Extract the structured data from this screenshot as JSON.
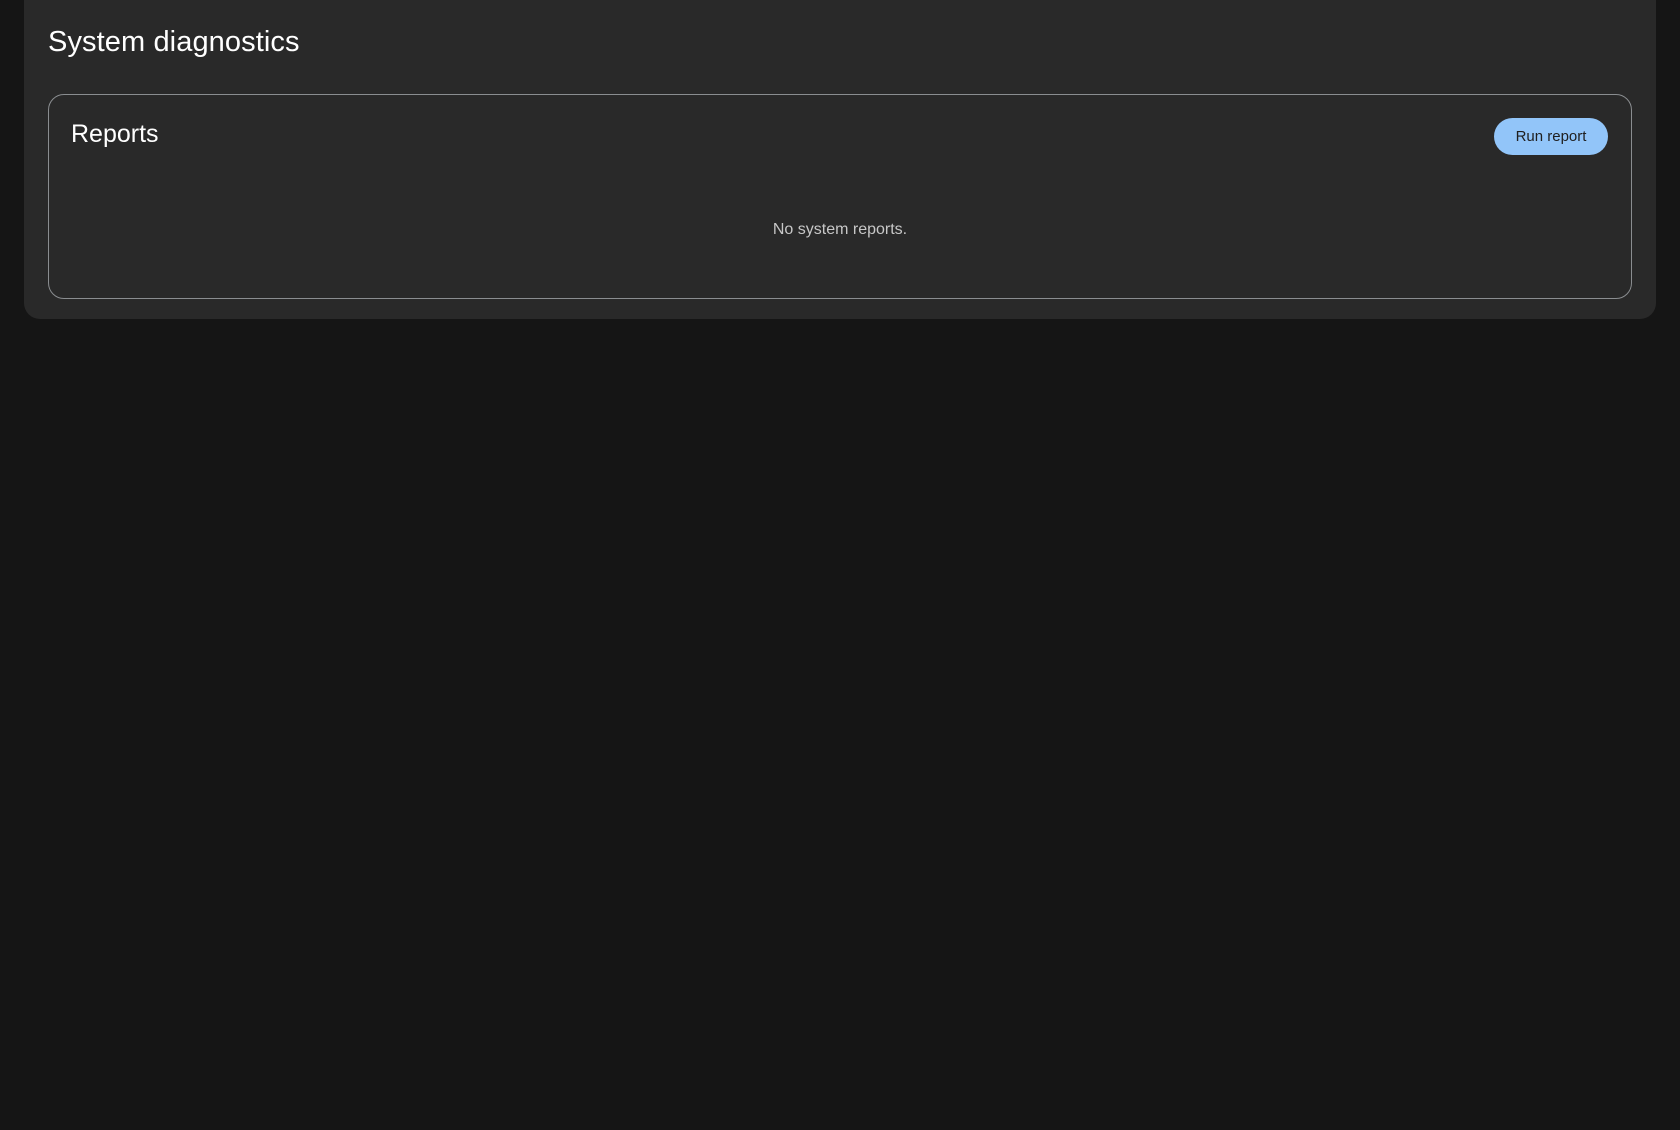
{
  "page": {
    "title": "System diagnostics"
  },
  "reports": {
    "title": "Reports",
    "run_button_label": "Run report",
    "empty_message": "No system reports."
  },
  "colors": {
    "background": "#151515",
    "surface": "#292929",
    "accent_button": "#92c5f9",
    "card_border": "#8a8d90"
  }
}
